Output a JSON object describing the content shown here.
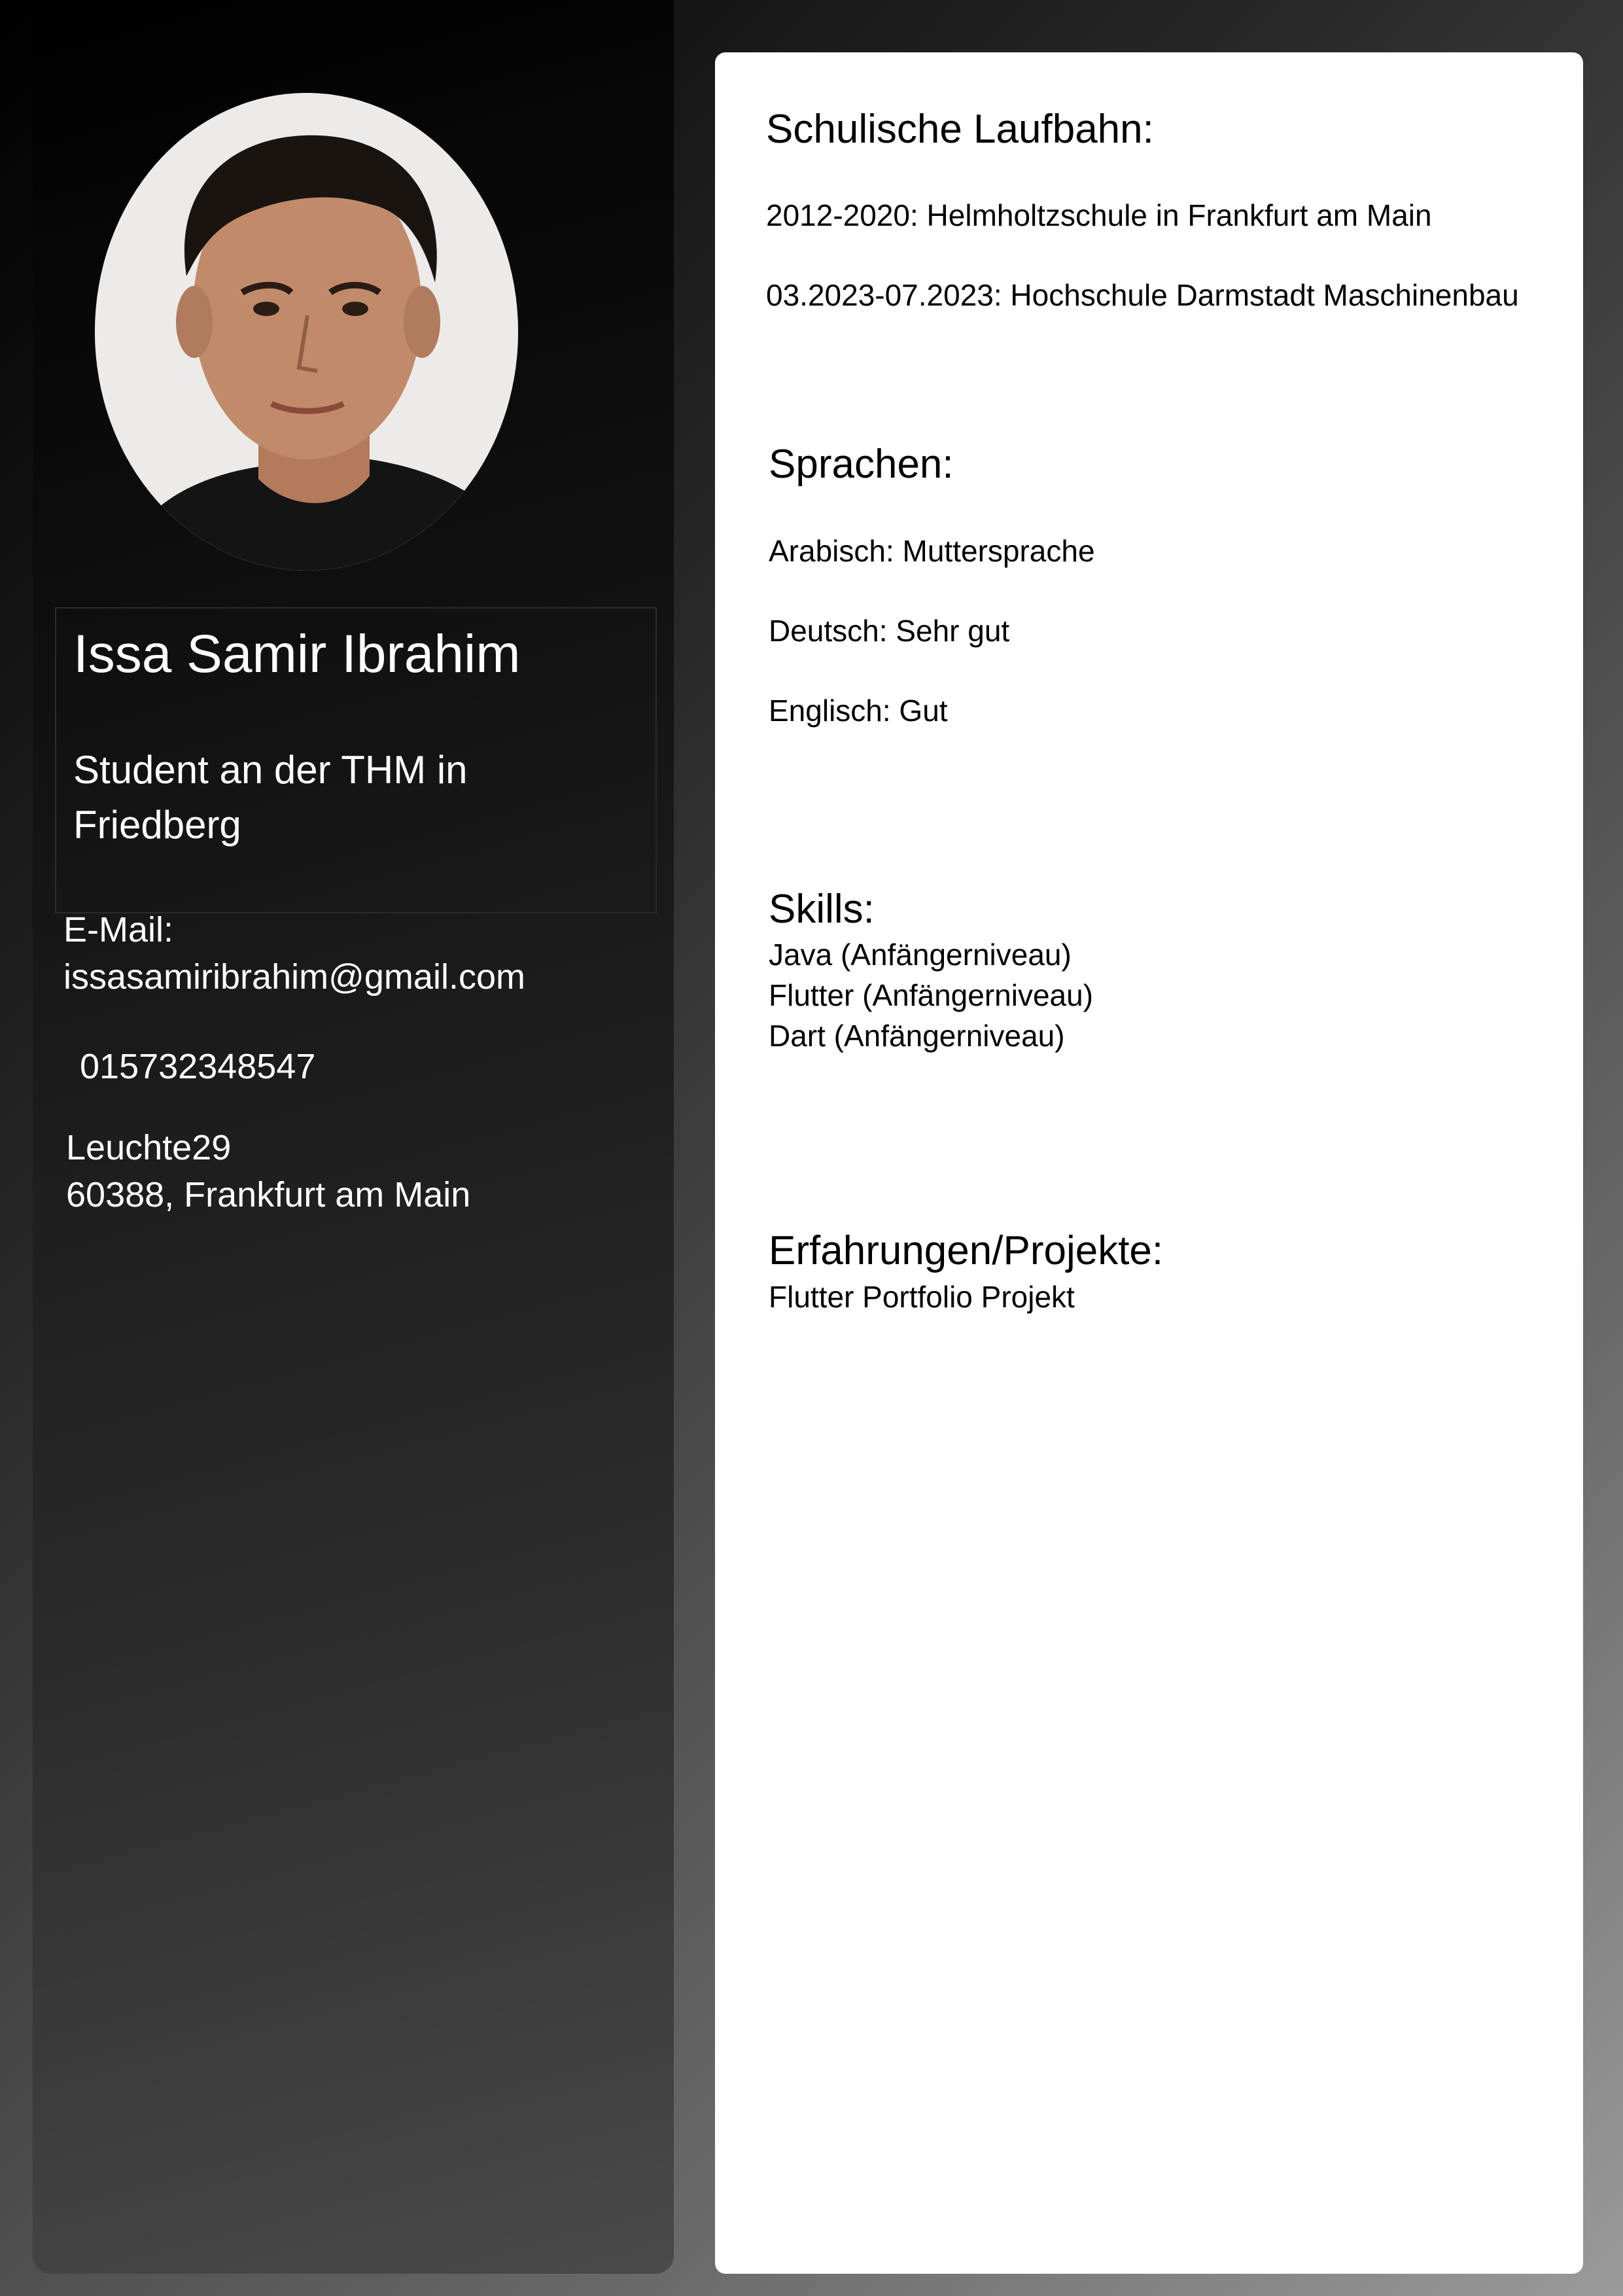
{
  "profile": {
    "name": "Issa Samir Ibrahim",
    "subtitle": "Student an der THM in Friedberg",
    "email_label": "E-Mail:",
    "email": "issasamiribrahim@gmail.com",
    "phone": "015732348547",
    "address_street": "Leuchte29",
    "address_city": "60388, Frankfurt am Main"
  },
  "education": {
    "heading": "Schulische Laufbahn:",
    "items": [
      "2012-2020: Helmholtzschule in Frankfurt am Main",
      "03.2023-07.2023: Hochschule Darmstadt Maschinenbau"
    ]
  },
  "languages": {
    "heading": "Sprachen:",
    "items": [
      "Arabisch: Muttersprache",
      "Deutsch: Sehr gut",
      "Englisch: Gut"
    ]
  },
  "skills": {
    "heading": "Skills:",
    "items": [
      "Java (Anfängerniveau)",
      "Flutter (Anfängerniveau)",
      "Dart (Anfängerniveau)"
    ]
  },
  "experience": {
    "heading": "Erfahrungen/Projekte:",
    "items": [
      "Flutter Portfolio Projekt"
    ]
  }
}
